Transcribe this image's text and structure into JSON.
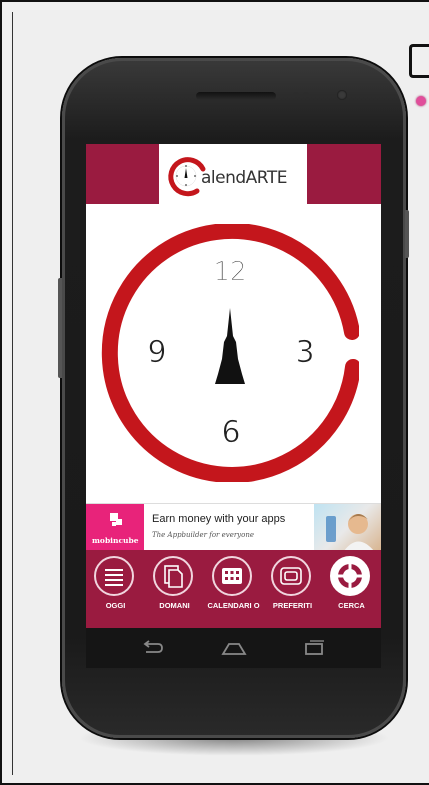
{
  "app": {
    "name_prefix": "C",
    "name": "alendARTE"
  },
  "clock": {
    "numbers": [
      "12",
      "3",
      "6",
      "9"
    ],
    "ring_color": "#c4161c",
    "hand_color": "#111111"
  },
  "ad": {
    "brand": "mobincube",
    "title": "Earn money with your apps",
    "subtitle": "The Appbuilder for everyone"
  },
  "tabs": [
    {
      "label": "OGGI",
      "icon": "list-icon"
    },
    {
      "label": "DOMANI",
      "icon": "documents-icon"
    },
    {
      "label": "CALENDARI O",
      "icon": "grid-icon"
    },
    {
      "label": "PREFERITI",
      "icon": "card-icon"
    },
    {
      "label": "CERCA",
      "icon": "crosshair-icon"
    }
  ],
  "colors": {
    "brand": "#9a1b40",
    "accent_pink": "#e8237a"
  }
}
